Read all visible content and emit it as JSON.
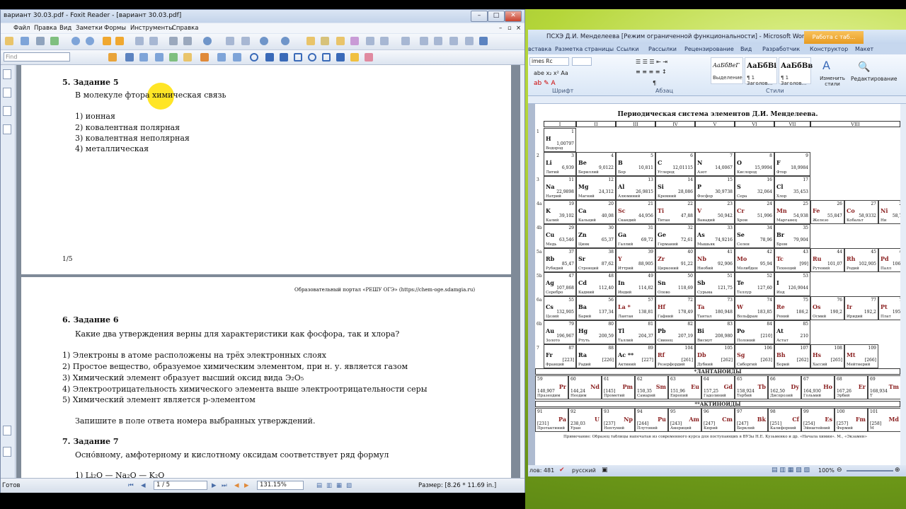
{
  "foxit": {
    "title": "вариант 30.03.pdf - Foxit Reader - [вариант 30.03.pdf]",
    "menu": [
      "Файл",
      "Правка",
      "Вид",
      "Заметки",
      "Формы",
      "Инструменты",
      "Справка"
    ],
    "find_placeholder": "Find",
    "page1": {
      "heading": "5. Задание 5",
      "question": "В молекуле фтора химическая связь",
      "options": [
        "1) ионная",
        "2) ковалентная полярная",
        "3) ковалентная неполярная",
        "4) металлическая"
      ],
      "page_num": "1/5"
    },
    "page2": {
      "header": "Образовательный портал «РЕШУ ОГЭ» (https://chem-oge.sdamgia.ru)",
      "heading6": "6. Задание 6",
      "question6": "Какие два утверждения верны для характеристики как фосфора, так и хлора?",
      "options6": [
        "1) Электроны в атоме расположены на трёх электронных слоях",
        "2) Простое вещество, образуемое химическим элементом, при н. у. является газом",
        "3) Химический элемент образует высший оксид вида Э₂O₅",
        "4) Электроотрицательность химического элемента выше электроотрицательности серы",
        "5) Химический элемент является р-элементом"
      ],
      "instruction": "Запишите в поле ответа номера выбранных утверждений.",
      "heading7": "7. Задание 7",
      "question7": "Осно́вному, амфотерному и кислотному оксидам соответствует ряд формул",
      "partial": "1) Li₂O — Na₂O — K₂O"
    },
    "status": {
      "ready": "Готов",
      "page": "1 / 5",
      "zoom": "131.15%",
      "size": "Размер: [8.26 * 11.69 in.]"
    }
  },
  "word": {
    "title": "ПСХЭ Д.И. Менделеева [Режим ограниченной функциональности] - Microsoft Word",
    "table_tools": "Работа с таб...",
    "tabs": [
      "вставка",
      "Разметка страницы",
      "Ссылки",
      "Рассылки",
      "Рецензирование",
      "Вид",
      "Разработчик",
      "Конструктор",
      "Макет"
    ],
    "font_name": "imes Rc",
    "groups": [
      "Шрифт",
      "Абзац",
      "Стили"
    ],
    "styles": [
      {
        "sample": "АаБбВеГ",
        "label": "Выделение"
      },
      {
        "sample": "АаБбВі",
        "label": "¶ 1 Заголов..."
      },
      {
        "sample": "АаБбВв",
        "label": "¶ 1 Заголов..."
      }
    ],
    "change_styles": "Изменить стили",
    "editing": "Редактирование",
    "table": {
      "title": "Периодическая система элементов Д.И. Менделеева.",
      "groups": [
        "I",
        "II",
        "III",
        "IV",
        "V",
        "VI",
        "VII",
        "VIII"
      ],
      "lanthanides": "*ЛАНТАНОИДЫ",
      "actinides": "**АКТИНОИДЫ",
      "note": "Примечание: Образец таблицы напечатан из современного курса для поступающих в ВУЗы Н.Е. Кузьменко и др. «Начала химии». М., «Экзамен»",
      "rows": [
        {
          "period": "1",
          "cells": [
            {
              "s": "H",
              "n": "1",
              "m": "1,00797",
              "name": "Водород"
            }
          ]
        },
        {
          "period": "2",
          "cells": [
            {
              "s": "Li",
              "n": "3",
              "m": "6,939",
              "name": "Литий"
            },
            {
              "s": "Be",
              "n": "4",
              "m": "9,0122",
              "name": "Бериллий"
            },
            {
              "s": "B",
              "n": "5",
              "m": "10,811",
              "name": "Бор"
            },
            {
              "s": "C",
              "n": "6",
              "m": "12,01115",
              "name": "Углерод"
            },
            {
              "s": "N",
              "n": "7",
              "m": "14,0067",
              "name": "Азот"
            },
            {
              "s": "O",
              "n": "8",
              "m": "15,9994",
              "name": "Кислород"
            },
            {
              "s": "F",
              "n": "9",
              "m": "18,9984",
              "name": "Фтор"
            }
          ]
        },
        {
          "period": "3",
          "cells": [
            {
              "s": "Na",
              "n": "11",
              "m": "22,9898",
              "name": "Натрий"
            },
            {
              "s": "Mg",
              "n": "12",
              "m": "24,312",
              "name": "Магний"
            },
            {
              "s": "Al",
              "n": "13",
              "m": "26,9815",
              "name": "Алюминий"
            },
            {
              "s": "Si",
              "n": "14",
              "m": "28,086",
              "name": "Кремний"
            },
            {
              "s": "P",
              "n": "15",
              "m": "30,9738",
              "name": "Фосфор"
            },
            {
              "s": "S",
              "n": "16",
              "m": "32,064",
              "name": "Сера"
            },
            {
              "s": "Cl",
              "n": "17",
              "m": "35,453",
              "name": "Хлор"
            }
          ]
        },
        {
          "period": "4a",
          "cells": [
            {
              "s": "K",
              "n": "19",
              "m": "39,102",
              "name": "Калий"
            },
            {
              "s": "Ca",
              "n": "20",
              "m": "40,08",
              "name": "Кальций"
            },
            {
              "s": "Sc",
              "n": "21",
              "m": "44,956",
              "name": "Скандий"
            },
            {
              "s": "Ti",
              "n": "22",
              "m": "47,88",
              "name": "Титан"
            },
            {
              "s": "V",
              "n": "23",
              "m": "50,942",
              "name": "Ванадий"
            },
            {
              "s": "Cr",
              "n": "24",
              "m": "51,996",
              "name": "Хром"
            },
            {
              "s": "Mn",
              "n": "25",
              "m": "54,938",
              "name": "Марганец"
            },
            {
              "s": "Fe",
              "n": "26",
              "m": "55,847",
              "name": "Железо"
            },
            {
              "s": "Co",
              "n": "27",
              "m": "58,9332",
              "name": "Кобальт"
            },
            {
              "s": "Ni",
              "n": "28",
              "m": "58,71",
              "name": "Ни"
            }
          ]
        },
        {
          "period": "4b",
          "cells": [
            {
              "s": "Cu",
              "n": "29",
              "m": "63,546",
              "name": "Медь"
            },
            {
              "s": "Zn",
              "n": "30",
              "m": "65,37",
              "name": "Цинк"
            },
            {
              "s": "Ga",
              "n": "31",
              "m": "69,72",
              "name": "Галлий"
            },
            {
              "s": "Ge",
              "n": "32",
              "m": "72,61",
              "name": "Германий"
            },
            {
              "s": "As",
              "n": "33",
              "m": "74,9216",
              "name": "Мышьяк"
            },
            {
              "s": "Se",
              "n": "34",
              "m": "78,96",
              "name": "Селен"
            },
            {
              "s": "Br",
              "n": "35",
              "m": "79,904",
              "name": "Бром"
            }
          ]
        },
        {
          "period": "5a",
          "cells": [
            {
              "s": "Rb",
              "n": "37",
              "m": "85,47",
              "name": "Рубидий"
            },
            {
              "s": "Sr",
              "n": "38",
              "m": "87,62",
              "name": "Стронций"
            },
            {
              "s": "Y",
              "n": "39",
              "m": "88,905",
              "name": "Иттрий"
            },
            {
              "s": "Zr",
              "n": "40",
              "m": "91,22",
              "name": "Цирконий"
            },
            {
              "s": "Nb",
              "n": "41",
              "m": "92,906",
              "name": "Ниобий"
            },
            {
              "s": "Mo",
              "n": "42",
              "m": "95,94",
              "name": "Молибден"
            },
            {
              "s": "Tc",
              "n": "43",
              "m": "[99]",
              "name": "Технеций"
            },
            {
              "s": "Ru",
              "n": "44",
              "m": "101,07",
              "name": "Рутений"
            },
            {
              "s": "Rh",
              "n": "45",
              "m": "102,905",
              "name": "Родий"
            },
            {
              "s": "Pd",
              "n": "46",
              "m": "106,4",
              "name": "Палл"
            }
          ]
        },
        {
          "period": "5b",
          "cells": [
            {
              "s": "Ag",
              "n": "47",
              "m": "107,868",
              "name": "Серебро"
            },
            {
              "s": "Cd",
              "n": "48",
              "m": "112,40",
              "name": "Кадмий"
            },
            {
              "s": "In",
              "n": "49",
              "m": "114,82",
              "name": "Индий"
            },
            {
              "s": "Sn",
              "n": "50",
              "m": "118,69",
              "name": "Олово"
            },
            {
              "s": "Sb",
              "n": "51",
              "m": "121,75",
              "name": "Сурьма"
            },
            {
              "s": "Te",
              "n": "52",
              "m": "127,60",
              "name": "Теллур"
            },
            {
              "s": "I",
              "n": "53",
              "m": "126,9044",
              "name": "Иод"
            }
          ]
        },
        {
          "period": "6a",
          "cells": [
            {
              "s": "Cs",
              "n": "55",
              "m": "132,905",
              "name": "Цезий"
            },
            {
              "s": "Ba",
              "n": "56",
              "m": "137,34",
              "name": "Барий"
            },
            {
              "s": "La *",
              "n": "57",
              "m": "138,81",
              "name": "Лантан"
            },
            {
              "s": "Hf",
              "n": "72",
              "m": "178,49",
              "name": "Гафний"
            },
            {
              "s": "Ta",
              "n": "73",
              "m": "180,948",
              "name": "Тантал"
            },
            {
              "s": "W",
              "n": "74",
              "m": "183,85",
              "name": "Вольфрам"
            },
            {
              "s": "Re",
              "n": "75",
              "m": "186,2",
              "name": "Рений"
            },
            {
              "s": "Os",
              "n": "76",
              "m": "190,2",
              "name": "Осмий"
            },
            {
              "s": "Ir",
              "n": "77",
              "m": "192,2",
              "name": "Иридий"
            },
            {
              "s": "Pt",
              "n": "78",
              "m": "195,0",
              "name": "Плат"
            }
          ]
        },
        {
          "period": "6b",
          "cells": [
            {
              "s": "Au",
              "n": "79",
              "m": "196,967",
              "name": "Золото"
            },
            {
              "s": "Hg",
              "n": "80",
              "m": "200,59",
              "name": "Ртуть"
            },
            {
              "s": "Tl",
              "n": "81",
              "m": "204,37",
              "name": "Таллий"
            },
            {
              "s": "Pb",
              "n": "82",
              "m": "207,19",
              "name": "Свинец"
            },
            {
              "s": "Bi",
              "n": "83",
              "m": "208,980",
              "name": "Висмут"
            },
            {
              "s": "Po",
              "n": "84",
              "m": "[210]",
              "name": "Полоний"
            },
            {
              "s": "At",
              "n": "85",
              "m": "210",
              "name": "Астат"
            }
          ]
        },
        {
          "period": "7",
          "cells": [
            {
              "s": "Fr",
              "n": "87",
              "m": "[223]",
              "name": "Франций"
            },
            {
              "s": "Ra",
              "n": "88",
              "m": "[226]",
              "name": "Радий"
            },
            {
              "s": "Ac **",
              "n": "89",
              "m": "[227]",
              "name": "Актиний"
            },
            {
              "s": "Rf",
              "n": "104",
              "m": "[261]",
              "name": "Резерфордий"
            },
            {
              "s": "Db",
              "n": "105",
              "m": "[262]",
              "name": "Дубний"
            },
            {
              "s": "Sg",
              "n": "106",
              "m": "[263]",
              "name": "Сиборгий"
            },
            {
              "s": "Bh",
              "n": "107",
              "m": "[262]",
              "name": "Борий"
            },
            {
              "s": "Hs",
              "n": "108",
              "m": "[265]",
              "name": "Хассий"
            },
            {
              "s": "Mt",
              "n": "109",
              "m": "[266]",
              "name": "Мейтнерий"
            }
          ]
        }
      ],
      "lanth": [
        {
          "s": "Pr",
          "n": "59",
          "m": "140,907",
          "name": "Празеодим"
        },
        {
          "s": "Nd",
          "n": "60",
          "m": "144,24",
          "name": "Неодим"
        },
        {
          "s": "Pm",
          "n": "61",
          "m": "[145]",
          "name": "Прометий"
        },
        {
          "s": "Sm",
          "n": "62",
          "m": "150,35",
          "name": "Самарий"
        },
        {
          "s": "Eu",
          "n": "63",
          "m": "151,96",
          "name": "Европий"
        },
        {
          "s": "Gd",
          "n": "64",
          "m": "157,25",
          "name": "Гадолиний"
        },
        {
          "s": "Tb",
          "n": "65",
          "m": "158,924",
          "name": "Тербий"
        },
        {
          "s": "Dy",
          "n": "66",
          "m": "162,50",
          "name": "Диспрозий"
        },
        {
          "s": "Ho",
          "n": "67",
          "m": "164,930",
          "name": "Гольмий"
        },
        {
          "s": "Er",
          "n": "68",
          "m": "167,26",
          "name": "Эрбий"
        },
        {
          "s": "Tm",
          "n": "69",
          "m": "168,934",
          "name": "Т"
        }
      ],
      "actin": [
        {
          "s": "Pa",
          "n": "91",
          "m": "[231]",
          "name": "Протактиний"
        },
        {
          "s": "U",
          "n": "92",
          "m": "238,03",
          "name": "Уран"
        },
        {
          "s": "Np",
          "n": "93",
          "m": "[237]",
          "name": "Нептуний"
        },
        {
          "s": "Pu",
          "n": "94",
          "m": "[244]",
          "name": "Плутоний"
        },
        {
          "s": "Am",
          "n": "95",
          "m": "[243]",
          "name": "Америций"
        },
        {
          "s": "Cm",
          "n": "96",
          "m": "[247]",
          "name": "Кюрий"
        },
        {
          "s": "Bk",
          "n": "97",
          "m": "[247]",
          "name": "Берклий"
        },
        {
          "s": "Cf",
          "n": "98",
          "m": "[251]",
          "name": "Калифорний"
        },
        {
          "s": "Es",
          "n": "99",
          "m": "[254]",
          "name": "Эйнштейний"
        },
        {
          "s": "Fm",
          "n": "100",
          "m": "[257]",
          "name": "Фермий"
        },
        {
          "s": "Md",
          "n": "101",
          "m": "[258]",
          "name": "М"
        }
      ]
    },
    "status": {
      "words": "лов: 481",
      "lang": "русский",
      "zoom": "100%"
    }
  },
  "colors": {
    "accent": "#f0a830",
    "symbol_red": "#8a1f1f",
    "highlight": "#ffe100"
  }
}
